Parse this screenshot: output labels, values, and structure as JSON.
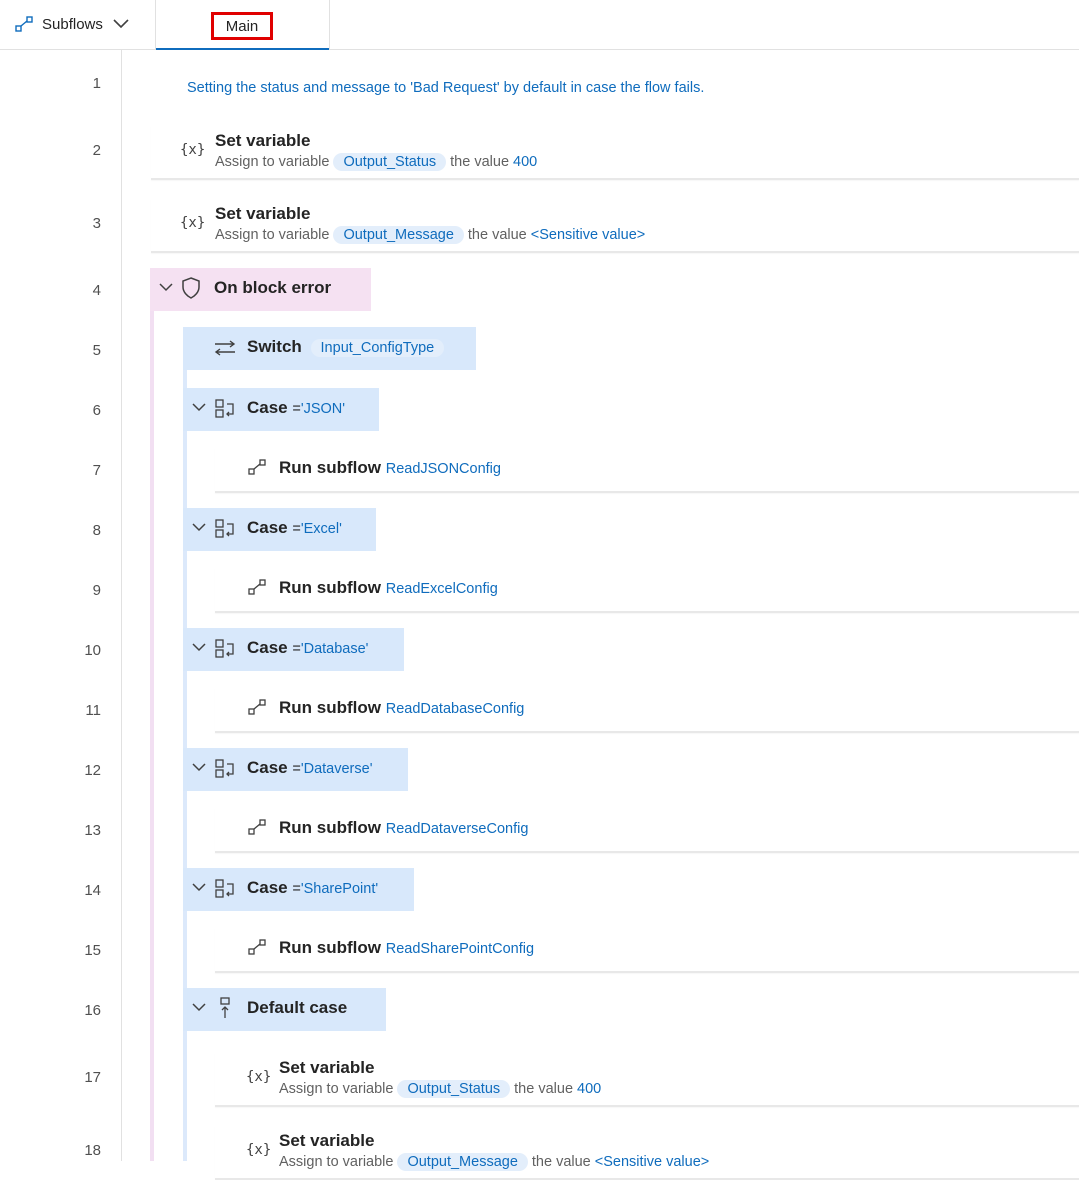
{
  "toolbar": {
    "subflows_label": "Subflows",
    "main_tab_label": "Main"
  },
  "line_numbers": [
    "1",
    "2",
    "3",
    "4",
    "5",
    "6",
    "7",
    "8",
    "9",
    "10",
    "11",
    "12",
    "13",
    "14",
    "15",
    "16",
    "17",
    "18"
  ],
  "actions": {
    "comment": "Setting the status and message to 'Bad Request' by default in case the flow fails.",
    "set1": {
      "title": "Set variable",
      "prefix": "Assign to variable",
      "var": "Output_Status",
      "mid": "the value",
      "value": "400"
    },
    "set2": {
      "title": "Set variable",
      "prefix": "Assign to variable",
      "var": "Output_Message",
      "mid": "the value",
      "value": "<Sensitive value>"
    },
    "block_error": {
      "title": "On block error"
    },
    "switch": {
      "title": "Switch",
      "var": "Input_ConfigType"
    },
    "cases": [
      {
        "title": "Case",
        "eq": "=",
        "value": "'JSON'",
        "run_title": "Run subflow",
        "subflow": "ReadJSONConfig"
      },
      {
        "title": "Case",
        "eq": "=",
        "value": "'Excel'",
        "run_title": "Run subflow",
        "subflow": "ReadExcelConfig"
      },
      {
        "title": "Case",
        "eq": "=",
        "value": "'Database'",
        "run_title": "Run subflow",
        "subflow": "ReadDatabaseConfig"
      },
      {
        "title": "Case",
        "eq": "=",
        "value": "'Dataverse'",
        "run_title": "Run subflow",
        "subflow": "ReadDataverseConfig"
      },
      {
        "title": "Case",
        "eq": "=",
        "value": "'SharePoint'",
        "run_title": "Run subflow",
        "subflow": "ReadSharePointConfig"
      }
    ],
    "default_case": {
      "title": "Default case"
    },
    "set3": {
      "title": "Set variable",
      "prefix": "Assign to variable",
      "var": "Output_Status",
      "mid": "the value",
      "value": "400"
    },
    "set4": {
      "title": "Set variable",
      "prefix": "Assign to variable",
      "var": "Output_Message",
      "mid": "the value",
      "value": "<Sensitive value>"
    }
  },
  "colors": {
    "accent": "#0f6cbd",
    "highlight_box": "#e00000",
    "error_block": "#f5e1f2",
    "switch_block": "#d8e8fb"
  },
  "icons": {
    "subflows": "subflow-icon",
    "chevron": "chevron-down-icon",
    "variable": "variable-icon",
    "shield": "shield-icon",
    "switch": "switch-icon",
    "case": "case-icon",
    "run": "run-subflow-icon",
    "default": "default-case-icon"
  }
}
